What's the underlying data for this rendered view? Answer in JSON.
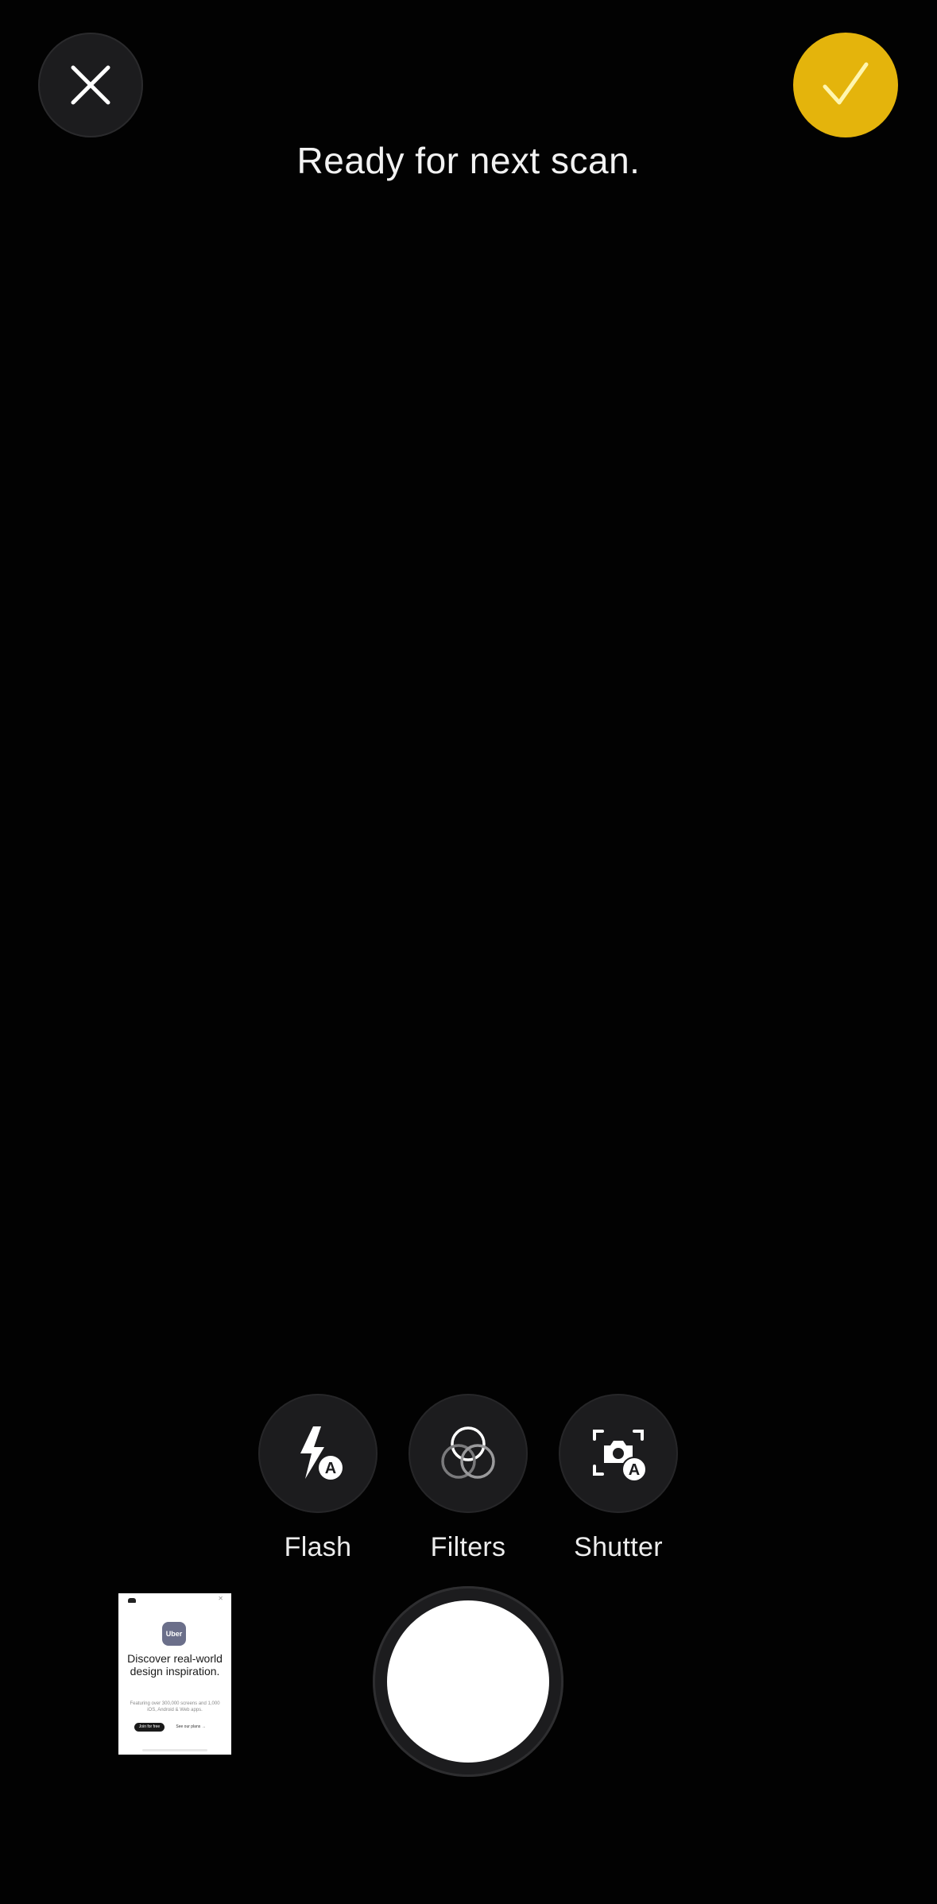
{
  "header": {
    "close_icon": "close-icon",
    "done_icon": "checkmark-icon",
    "status": "Ready for next scan."
  },
  "tools": {
    "flash": {
      "label": "Flash",
      "icon": "flash-auto-icon"
    },
    "filters": {
      "label": "Filters",
      "icon": "filters-icon"
    },
    "shutter": {
      "label": "Shutter",
      "icon": "auto-shutter-icon"
    }
  },
  "thumbnail": {
    "app_name": "Uber",
    "headline": "Discover real-world design inspiration.",
    "subtext": "Featuring over 300,000 screens and 1,000 iOS, Android & Web apps.",
    "primary_button": "Join for free",
    "secondary_button": "See our plans →"
  },
  "colors": {
    "background": "#000000",
    "accent_yellow": "#e4b40c",
    "control_fill": "#1c1c1e",
    "text": "#f2f2f2"
  }
}
